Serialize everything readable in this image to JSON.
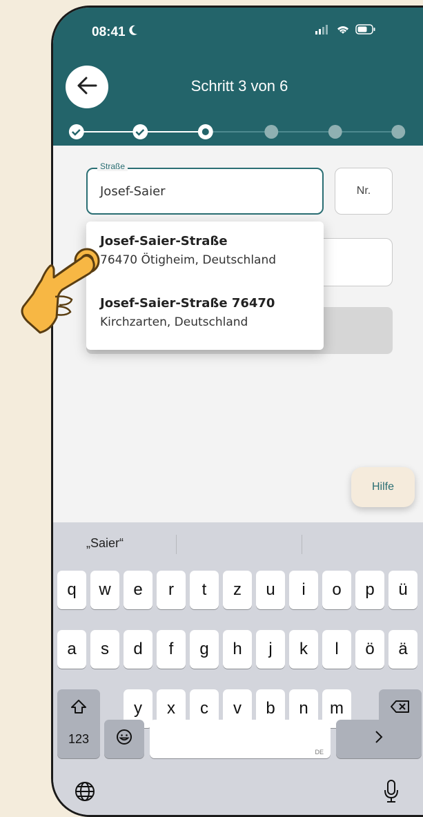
{
  "status_bar": {
    "time": "08:41"
  },
  "header": {
    "step_title": "Schritt 3 von 6"
  },
  "form": {
    "street_label": "Straße",
    "street_value": "Josef-Saier",
    "number_placeholder": "Nr."
  },
  "suggestions": [
    {
      "title": "Josef-Saier-Straße",
      "subtitle": "76470 Ötigheim, Deutschland"
    },
    {
      "title": "Josef-Saier-Straße 76470",
      "subtitle": "Kirchzarten, Deutschland"
    }
  ],
  "help_label": "Hilfe",
  "keyboard": {
    "suggestion": "„Saier“",
    "row1": [
      "q",
      "w",
      "e",
      "r",
      "t",
      "z",
      "u",
      "i",
      "o",
      "p",
      "ü"
    ],
    "row2": [
      "a",
      "s",
      "d",
      "f",
      "g",
      "h",
      "j",
      "k",
      "l",
      "ö",
      "ä"
    ],
    "row3": [
      "y",
      "x",
      "c",
      "v",
      "b",
      "n",
      "m"
    ],
    "numbers_label": "123",
    "space_lang": "DE"
  },
  "colors": {
    "primary": "#23646a",
    "background": "#f4ecdc",
    "accent_orange": "#f7b744"
  }
}
